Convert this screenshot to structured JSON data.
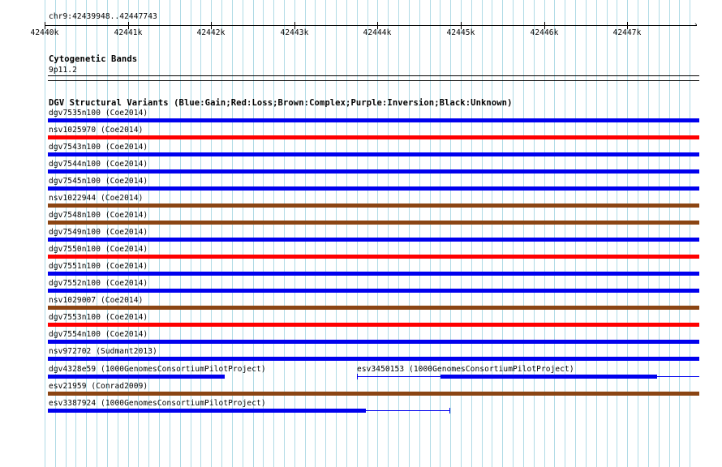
{
  "ruler": {
    "range_label": "chr9:42439948..42447743",
    "ticks": [
      "42440k",
      "42441k",
      "42442k",
      "42443k",
      "42444k",
      "42445k",
      "42446k",
      "42447k"
    ]
  },
  "cytoband": {
    "track_title": "Cytogenetic Bands",
    "band": "9p11.2"
  },
  "dgv": {
    "track_title": "DGV Structural Variants (Blue:Gain;Red:Loss;Brown:Complex;Purple:Inversion;Black:Unknown)",
    "colors": {
      "gain": "#0000ee",
      "loss": "#ff0000",
      "complex": "#8b4513",
      "grid": "#b0dbe6"
    },
    "rows": [
      {
        "label": "dgv7535n100 (Coe2014)",
        "type": "gain"
      },
      {
        "label": "nsv1025970 (Coe2014)",
        "type": "loss"
      },
      {
        "label": "dgv7543n100 (Coe2014)",
        "type": "gain"
      },
      {
        "label": "dgv7544n100 (Coe2014)",
        "type": "gain"
      },
      {
        "label": "dgv7545n100 (Coe2014)",
        "type": "gain"
      },
      {
        "label": "nsv1022944 (Coe2014)",
        "type": "complex"
      },
      {
        "label": "dgv7548n100 (Coe2014)",
        "type": "complex"
      },
      {
        "label": "dgv7549n100 (Coe2014)",
        "type": "gain"
      },
      {
        "label": "dgv7550n100 (Coe2014)",
        "type": "loss"
      },
      {
        "label": "dgv7551n100 (Coe2014)",
        "type": "gain"
      },
      {
        "label": "dgv7552n100 (Coe2014)",
        "type": "gain"
      },
      {
        "label": "nsv1029007 (Coe2014)",
        "type": "complex"
      },
      {
        "label": "dgv7553n100 (Coe2014)",
        "type": "loss"
      },
      {
        "label": "dgv7554n100 (Coe2014)",
        "type": "gain"
      },
      {
        "label": "nsv972702 (Sudmant2013)",
        "type": "gain"
      }
    ],
    "split_row": {
      "left_label": "dgv4328e59 (1000GenomesConsortiumPilotProject)",
      "right_label": "esv3450153 (1000GenomesConsortiumPilotProject)",
      "type": "gain"
    },
    "complex_row": {
      "label": "esv21959 (Conrad2009)",
      "type": "complex"
    },
    "last_row": {
      "label": "esv3387924 (1000GenomesConsortiumPilotProject)",
      "type": "gain"
    }
  }
}
